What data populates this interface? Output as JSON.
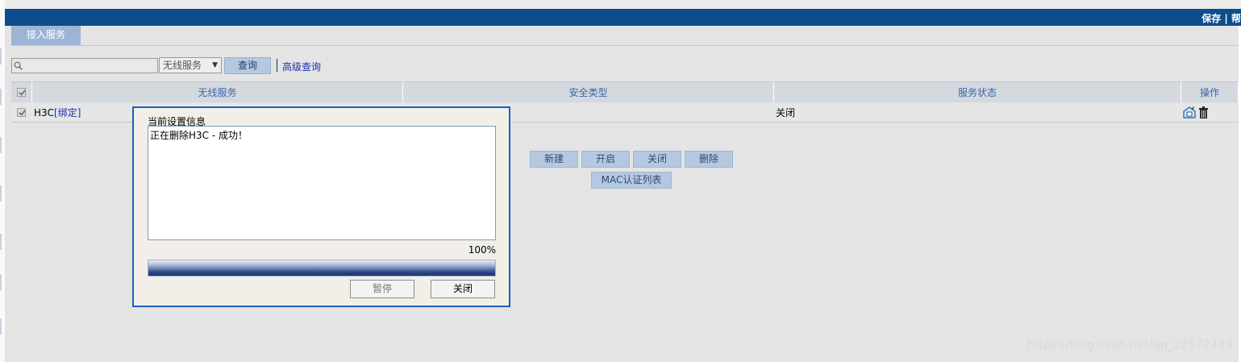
{
  "header": {
    "links_text": "保存 | 帮"
  },
  "tabs": [
    {
      "label": "接入服务",
      "active": true
    }
  ],
  "toolbar": {
    "search_value": "",
    "filter_select": "无线服务",
    "query_button": "查询",
    "advanced_query_link": "高级查询"
  },
  "table": {
    "columns": [
      "无线服务",
      "安全类型",
      "服务状态",
      "操作"
    ],
    "rows": [
      {
        "service_name": "H3C",
        "bind_link": "[绑定]",
        "security_type": "",
        "status": "关闭",
        "checked": true
      }
    ]
  },
  "actions": {
    "new": "新建",
    "enable": "开启",
    "disable": "关闭",
    "delete": "删除",
    "mac_auth_list": "MAC认证列表"
  },
  "dialog": {
    "title": "当前设置信息",
    "message": "正在删除H3C - 成功！",
    "progress_percent_text": "100%",
    "progress_value": 1.0,
    "pause_button": "暂停",
    "close_button": "关闭"
  },
  "watermark": "https://blog.csdn.net/qq_22572439",
  "colors": {
    "topbar": "#0e4d8c",
    "tab": "#9db4d6",
    "button": "#b6c8e0",
    "link": "#1a2fb0",
    "dialog_border": "#1f5fbf"
  }
}
